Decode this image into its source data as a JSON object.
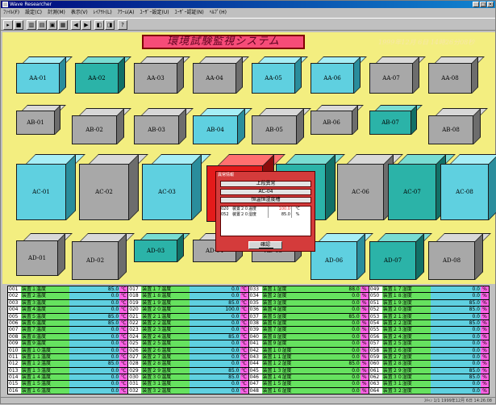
{
  "window": {
    "title": "Wave Researcher"
  },
  "menu": [
    "ﾌｧｲﾙ(F)",
    "設定(C)",
    "計測(M)",
    "表示(V)",
    "ﾚｲｱｳﾄ(L)",
    "ｱﾗｰﾑ(A)",
    "ﾕｰｻﾞｰ設定(U)",
    "ﾕｰｻﾞｰ認証(N)",
    "ﾍﾙﾌﾟ(H)"
  ],
  "app_title": "環境試験監視システム",
  "clock": "1999年12月 6日 14時26分08秒",
  "rooms": [
    "AA-01",
    "AA-02",
    "AA-03",
    "AA-04",
    "AA-05",
    "AA-06",
    "AA-07",
    "AA-08",
    "AB-01",
    "AB-02",
    "AB-03",
    "AB-04",
    "AB-05",
    "AB-06",
    "AB-07",
    "AB-08",
    "AC-01",
    "AC-02",
    "AC-03",
    "AC-04",
    "AC-05",
    "AC-06",
    "AC-07",
    "AC-08",
    "AD-01",
    "AD-02",
    "AD-03",
    "AD-04",
    "AD-05",
    "AD-06",
    "AD-07",
    "AD-08"
  ],
  "dialog": {
    "title": "異常情報",
    "location_label": "上段異常",
    "room": "AC-04",
    "type": "恒温恒湿度槽",
    "rows": [
      {
        "no": "020",
        "name": "装置２０温度",
        "value": "100.0",
        "unit": "℃"
      },
      {
        "no": "052",
        "name": "装置２０湿度",
        "value": "85.0",
        "unit": "%"
      }
    ],
    "ok": "確認"
  },
  "readings": [
    [
      [
        "001",
        "装置１温度",
        "85.0",
        "℃"
      ],
      [
        "002",
        "装置２温度",
        "0.0",
        "℃"
      ],
      [
        "003",
        "装置３温度",
        "0.0",
        "℃"
      ],
      [
        "004",
        "装置４温度",
        "0.0",
        "℃"
      ],
      [
        "005",
        "装置５温度",
        "85.0",
        "℃"
      ],
      [
        "006",
        "装置６温度",
        "85.0",
        "℃"
      ],
      [
        "007",
        "装置７温度",
        "0.0",
        "℃"
      ],
      [
        "008",
        "装置８温度",
        "0.0",
        "℃"
      ],
      [
        "009",
        "装置９温度",
        "0.0",
        "℃"
      ],
      [
        "010",
        "装置１０温度",
        "0.0",
        "℃"
      ],
      [
        "011",
        "装置１１温度",
        "0.0",
        "℃"
      ],
      [
        "012",
        "装置１２温度",
        "85.0",
        "℃"
      ],
      [
        "013",
        "装置１３温度",
        "0.0",
        "℃"
      ],
      [
        "014",
        "装置１４温度",
        "0.0",
        "℃"
      ],
      [
        "015",
        "装置１５温度",
        "0.0",
        "℃"
      ],
      [
        "016",
        "装置１６温度",
        "0.0",
        "℃"
      ]
    ],
    [
      [
        "017",
        "装置１７温度",
        "0.0",
        "℃"
      ],
      [
        "018",
        "装置１８温度",
        "0.0",
        "℃"
      ],
      [
        "019",
        "装置１９温度",
        "85.0",
        "℃"
      ],
      [
        "020",
        "装置２０温度",
        "100.0",
        "℃"
      ],
      [
        "021",
        "装置２１温度",
        "0.0",
        "℃"
      ],
      [
        "022",
        "装置２２温度",
        "0.0",
        "℃"
      ],
      [
        "023",
        "装置２３温度",
        "0.0",
        "℃"
      ],
      [
        "024",
        "装置２４温度",
        "85.0",
        "℃"
      ],
      [
        "025",
        "装置２５温度",
        "0.0",
        "℃"
      ],
      [
        "026",
        "装置２６温度",
        "0.0",
        "℃"
      ],
      [
        "027",
        "装置２７温度",
        "0.0",
        "℃"
      ],
      [
        "028",
        "装置２８温度",
        "0.0",
        "℃"
      ],
      [
        "029",
        "装置２９温度",
        "85.0",
        "℃"
      ],
      [
        "030",
        "装置３０温度",
        "85.0",
        "℃"
      ],
      [
        "031",
        "装置３１温度",
        "0.0",
        "℃"
      ],
      [
        "032",
        "装置３２温度",
        "0.0",
        "℃"
      ]
    ],
    [
      [
        "033",
        "装置１湿度",
        "88.0",
        "%"
      ],
      [
        "034",
        "装置２湿度",
        "0.0",
        "%"
      ],
      [
        "035",
        "装置３湿度",
        "0.0",
        "%"
      ],
      [
        "036",
        "装置４湿度",
        "0.0",
        "%"
      ],
      [
        "037",
        "装置５湿度",
        "85.0",
        "%"
      ],
      [
        "038",
        "装置６湿度",
        "0.0",
        "%"
      ],
      [
        "039",
        "装置７湿度",
        "0.0",
        "%"
      ],
      [
        "040",
        "装置８湿度",
        "0.0",
        "%"
      ],
      [
        "041",
        "装置９湿度",
        "0.0",
        "%"
      ],
      [
        "042",
        "装置１０湿度",
        "0.0",
        "%"
      ],
      [
        "043",
        "装置１１湿度",
        "0.0",
        "%"
      ],
      [
        "044",
        "装置１２湿度",
        "85.0",
        "%"
      ],
      [
        "045",
        "装置１３湿度",
        "0.0",
        "%"
      ],
      [
        "046",
        "装置１４湿度",
        "0.0",
        "%"
      ],
      [
        "047",
        "装置１５湿度",
        "0.0",
        "%"
      ],
      [
        "048",
        "装置１６湿度",
        "0.0",
        "%"
      ]
    ],
    [
      [
        "049",
        "装置１７湿度",
        "0.0",
        "%"
      ],
      [
        "050",
        "装置１８湿度",
        "0.0",
        "%"
      ],
      [
        "051",
        "装置１９湿度",
        "85.0",
        "%"
      ],
      [
        "052",
        "装置２０湿度",
        "85.0",
        "%"
      ],
      [
        "053",
        "装置２１湿度",
        "0.0",
        "%"
      ],
      [
        "054",
        "装置２２湿度",
        "85.0",
        "%"
      ],
      [
        "055",
        "装置２３湿度",
        "0.0",
        "%"
      ],
      [
        "056",
        "装置２４湿度",
        "0.0",
        "%"
      ],
      [
        "057",
        "装置２５湿度",
        "0.0",
        "%"
      ],
      [
        "058",
        "装置２６湿度",
        "0.0",
        "%"
      ],
      [
        "059",
        "装置２７湿度",
        "0.0",
        "%"
      ],
      [
        "060",
        "装置２８湿度",
        "0.0",
        "%"
      ],
      [
        "061",
        "装置２９湿度",
        "85.0",
        "%"
      ],
      [
        "062",
        "装置３０湿度",
        "85.0",
        "%"
      ],
      [
        "063",
        "装置３１湿度",
        "0.0",
        "%"
      ],
      [
        "064",
        "装置３２湿度",
        "0.0",
        "%"
      ]
    ]
  ],
  "column_value_colors": [
    "#5fd0e0",
    "#5fd0e0",
    "#66e25f",
    "#5fd0e0"
  ],
  "status": "ｽｷｬﾝ 1/1 1999年12月 6日 14:26:08"
}
